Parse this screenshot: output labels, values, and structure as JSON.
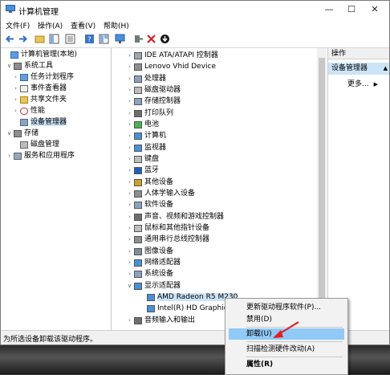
{
  "window": {
    "title": "计算机管理",
    "minimize": "—",
    "maximize": "☐",
    "close": "✕"
  },
  "menu": [
    "文件(F)",
    "操作(A)",
    "查看(V)",
    "帮助(H)"
  ],
  "left_tree": [
    {
      "label": "计算机管理(本地)",
      "exp": "",
      "indent": 0
    },
    {
      "label": "系统工具",
      "exp": "∨",
      "indent": 1
    },
    {
      "label": "任务计划程序",
      "exp": "›",
      "indent": 2
    },
    {
      "label": "事件查看器",
      "exp": "›",
      "indent": 2
    },
    {
      "label": "共享文件夹",
      "exp": "›",
      "indent": 2
    },
    {
      "label": "性能",
      "exp": "›",
      "indent": 2
    },
    {
      "label": "设备管理器",
      "exp": "",
      "indent": 2
    },
    {
      "label": "存储",
      "exp": "∨",
      "indent": 1
    },
    {
      "label": "磁盘管理",
      "exp": "",
      "indent": 2
    },
    {
      "label": "服务和应用程序",
      "exp": "›",
      "indent": 1
    }
  ],
  "devices": [
    {
      "label": "IDE ATA/ATAPI 控制器",
      "exp": "›",
      "indent": 0
    },
    {
      "label": "Lenovo Vhid Device",
      "exp": "›",
      "indent": 0
    },
    {
      "label": "处理器",
      "exp": "›",
      "indent": 0
    },
    {
      "label": "磁盘驱动器",
      "exp": "›",
      "indent": 0
    },
    {
      "label": "存储控制器",
      "exp": "›",
      "indent": 0
    },
    {
      "label": "打印队列",
      "exp": "›",
      "indent": 0
    },
    {
      "label": "电池",
      "exp": "›",
      "indent": 0
    },
    {
      "label": "计算机",
      "exp": "›",
      "indent": 0
    },
    {
      "label": "监视器",
      "exp": "›",
      "indent": 0
    },
    {
      "label": "键盘",
      "exp": "›",
      "indent": 0
    },
    {
      "label": "蓝牙",
      "exp": "›",
      "indent": 0
    },
    {
      "label": "其他设备",
      "exp": "›",
      "indent": 0
    },
    {
      "label": "人体学输入设备",
      "exp": "›",
      "indent": 0
    },
    {
      "label": "软件设备",
      "exp": "›",
      "indent": 0
    },
    {
      "label": "声音、视频和游戏控制器",
      "exp": "›",
      "indent": 0
    },
    {
      "label": "鼠标和其他指针设备",
      "exp": "›",
      "indent": 0
    },
    {
      "label": "通用串行总线控制器",
      "exp": "›",
      "indent": 0
    },
    {
      "label": "图像设备",
      "exp": "›",
      "indent": 0
    },
    {
      "label": "网络适配器",
      "exp": "›",
      "indent": 0
    },
    {
      "label": "系统设备",
      "exp": "›",
      "indent": 0
    },
    {
      "label": "显示适配器",
      "exp": "∨",
      "indent": 0
    },
    {
      "label": "AMD Radeon R5 M230",
      "exp": "",
      "indent": 1
    },
    {
      "label": "Intel(R) HD Graphics",
      "exp": "",
      "indent": 1
    },
    {
      "label": "音频输入和输出",
      "exp": "›",
      "indent": 0
    }
  ],
  "actions": {
    "header": "操作",
    "section": "设备管理器",
    "more": "更多..."
  },
  "context_menu": {
    "update": "更新驱动程序软件(P)...",
    "disable": "禁用(D)",
    "uninstall": "卸载(U)",
    "scan": "扫描检测硬件改动(A)",
    "properties": "属性(R)"
  },
  "status": "为所选设备卸载该驱动程序。",
  "colors": {
    "selection": "#cce4f7",
    "menu_highlight": "#91c9f7",
    "annotation": "#e02020"
  }
}
